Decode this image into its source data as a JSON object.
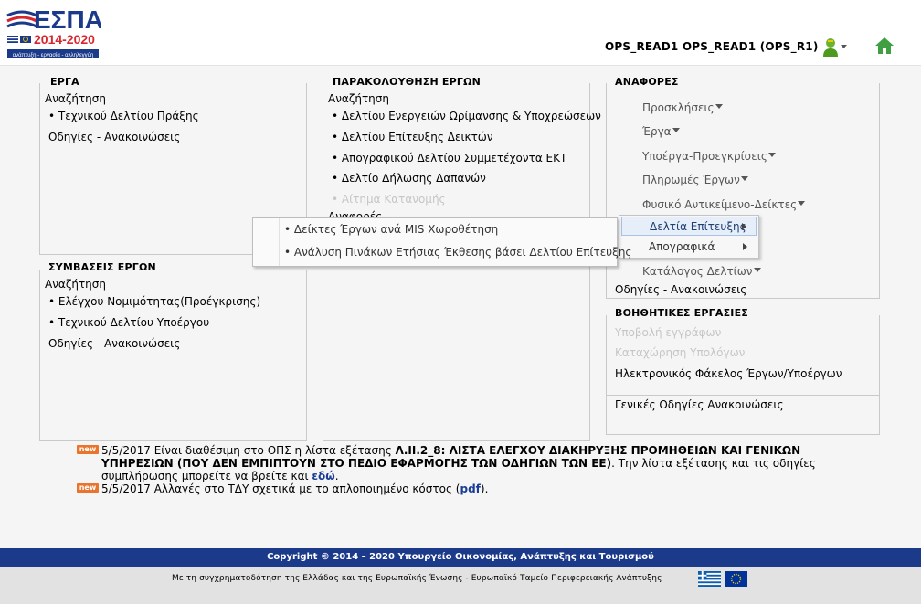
{
  "header": {
    "logo_word": "ΕΣΠΑ",
    "logo_years": "2014-2020",
    "logo_tagline": "ανάπτυξη - εργασία - αλληλεγγύη",
    "user_label": "OPS_READ1 OPS_READ1 (OPS_R1)",
    "user_icon": "user-menu-icon",
    "home_icon": "home-icon"
  },
  "panels": {
    "erga": {
      "title": "ΕΡΓΑ",
      "search_label": "Αναζήτηση",
      "items": [
        "• Τεχνικού Δελτίου Πράξης"
      ],
      "notices": "Οδηγίες - Ανακοινώσεις"
    },
    "symvaseis": {
      "title": "ΣΥΜΒΑΣΕΙΣ ΕΡΓΩΝ",
      "search_label": "Αναζήτηση",
      "items": [
        "• Ελέγχου Νομιμότητας(Προέγκρισης)",
        "• Τεχνικού Δελτίου Υποέργου"
      ],
      "notices": "Οδηγίες - Ανακοινώσεις"
    },
    "parakolouthisi": {
      "title": "ΠΑΡΑΚΟΛΟΥΘΗΣΗ ΕΡΓΩΝ",
      "search_label": "Αναζήτηση",
      "items": [
        "• Δελτίου Ενεργειών Ωρίμανσης & Υποχρεώσεων",
        "• Δελτίου Επίτευξης Δεικτών",
        "• Απογραφικού Δελτίου Συμμετέχοντα ΕΚΤ",
        "• Δελτίο Δήλωσης Δαπανών"
      ],
      "disabled_item": "• Αίτημα Κατανομής",
      "reports_label": "Αναφορές"
    },
    "anafores": {
      "title": "ΑΝΑΦΟΡΕΣ",
      "items": [
        "Προσκλήσεις",
        "Έργα",
        "Υποέργα-Προεγκρίσεις",
        "Πληρωμές Έργων",
        "Φυσικό Αντικείμενο-Δείκτες"
      ],
      "catalog": "Κατάλογος Δελτίων",
      "notices": "Οδηγίες - Ανακοινώσεις"
    },
    "voithitikes": {
      "title": "ΒΟΗΘΗΤΙΚΕΣ ΕΡΓΑΣΙΕΣ",
      "disabled_items": [
        "Υποβολή εγγράφων",
        "Καταχώρηση Υπολόγων"
      ],
      "item": "Ηλεκτρονικός Φάκελος Έργων/Υποέργων",
      "general": "Γενικές Οδηγίες Ανακοινώσεις"
    }
  },
  "submenu": {
    "items": [
      "Δελτία Επίτευξης",
      "Απογραφικά"
    ],
    "active_index": 0
  },
  "popup": {
    "items": [
      "• Δείκτες Έργων ανά MIS Χωροθέτηση",
      "• Ανάλυση Πινάκων Ετήσιας Έκθεσης βάσει Δελτίου Επίτευξης"
    ]
  },
  "news": {
    "badge": "new",
    "item1_prefix": "5/5/2017 Είναι διαθέσιμη στο ΟΠΣ η λίστα εξέτασης ",
    "item1_bold": "Λ.ΙΙ.2_8: ΛΙΣΤΑ ΕΛΕΓΧΟΥ ΔΙΑΚΗΡΥΞΗΣ ΠΡΟΜΗΘΕΙΩΝ ΚΑΙ ΓΕΝΙΚΩΝ ΥΠΗΡΕΣΙΩΝ (ΠΟΥ ΔΕΝ ΕΜΠΙΠΤΟΥΝ ΣΤΟ ΠΕΔΙΟ ΕΦΑΡΜΟΓΗΣ ΤΩΝ ΟΔΗΓΙΩΝ ΤΩΝ ΕΕ)",
    "item1_suffix": ". Την λίστα εξέτασης και τις οδηγίες συμπλήρωσης μπορείτε να βρείτε και ",
    "item1_link": "εδώ",
    "item1_end": ".",
    "item2_prefix": "5/5/2017 Αλλαγές στο ΤΔΥ σχετικά με το απλοποιημένο κόστος (",
    "item2_link": "pdf",
    "item2_end": ")."
  },
  "footer": {
    "copyright": "Copyright © 2014 – 2020 Υπουργείο Οικονομίας, Ανάπτυξης και Τουρισμού",
    "cofunding": "Με τη συγχρηματοδότηση της Ελλάδας και της Ευρωπαϊκής Ένωσης - Ευρωπαϊκό Ταμείο Περιφερειακής Ανάπτυξης",
    "flag_gr": "greek-flag-icon",
    "flag_eu": "eu-flag-icon"
  },
  "colors": {
    "brand_blue": "#1c3a8a",
    "logo_red": "#d7262d",
    "home_green": "#3ea040",
    "new_badge": "#e8742d"
  }
}
